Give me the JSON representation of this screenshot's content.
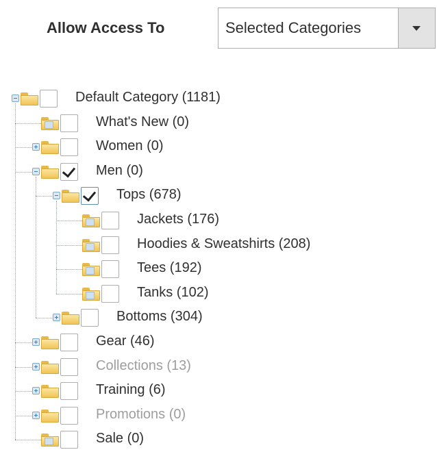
{
  "access": {
    "label": "Allow Access To",
    "selected": "Selected Categories"
  },
  "icons": {
    "expander": "tree-expander-icon",
    "folder": "folder-icon",
    "dropdown": "dropdown-arrow-icon"
  },
  "tree": [
    {
      "label": "Default Category (1181)",
      "level": 0,
      "expander": "minus",
      "checked": false,
      "disabled": false
    },
    {
      "label": "What's New (0)",
      "level": 1,
      "expander": "none",
      "checked": false,
      "disabled": false
    },
    {
      "label": "Women (0)",
      "level": 1,
      "expander": "plus",
      "checked": false,
      "disabled": false
    },
    {
      "label": "Men (0)",
      "level": 1,
      "expander": "minus",
      "checked": true,
      "disabled": false
    },
    {
      "label": "Tops (678)",
      "level": 2,
      "expander": "minus",
      "checked": true,
      "disabled": false
    },
    {
      "label": "Jackets (176)",
      "level": 3,
      "expander": "none",
      "checked": false,
      "disabled": false
    },
    {
      "label": "Hoodies & Sweatshirts (208)",
      "level": 3,
      "expander": "none",
      "checked": false,
      "disabled": false
    },
    {
      "label": "Tees (192)",
      "level": 3,
      "expander": "none",
      "checked": false,
      "disabled": false
    },
    {
      "label": "Tanks (102)",
      "level": 3,
      "expander": "none",
      "checked": false,
      "disabled": false
    },
    {
      "label": "Bottoms (304)",
      "level": 2,
      "expander": "plus",
      "checked": false,
      "disabled": false
    },
    {
      "label": "Gear (46)",
      "level": 1,
      "expander": "plus",
      "checked": false,
      "disabled": false
    },
    {
      "label": "Collections (13)",
      "level": 1,
      "expander": "plus",
      "checked": false,
      "disabled": true
    },
    {
      "label": "Training (6)",
      "level": 1,
      "expander": "plus",
      "checked": false,
      "disabled": false
    },
    {
      "label": "Promotions (0)",
      "level": 1,
      "expander": "plus",
      "checked": false,
      "disabled": true
    },
    {
      "label": "Sale (0)",
      "level": 1,
      "expander": "none",
      "checked": false,
      "disabled": false
    }
  ]
}
